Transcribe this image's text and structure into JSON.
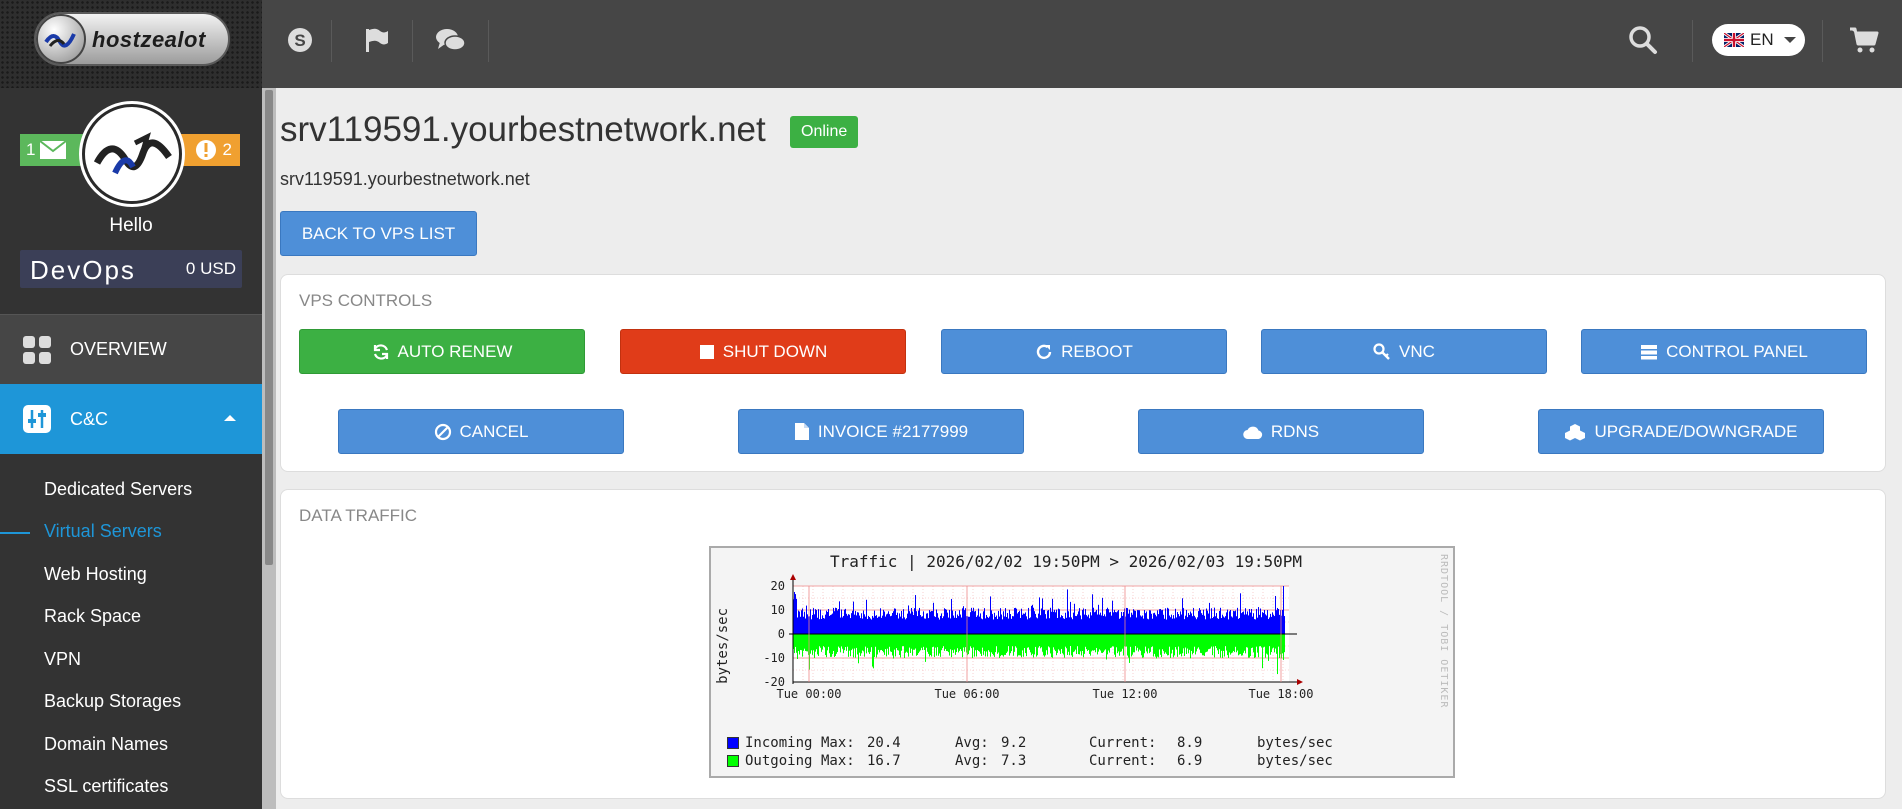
{
  "brand": {
    "logo_text": "hostzealot"
  },
  "topbar": {
    "icons": [
      "skype-icon",
      "flag-icon",
      "chat-icon"
    ],
    "language": "EN"
  },
  "sidebar": {
    "messages_count": "1",
    "alerts_count": "2",
    "greeting": "Hello",
    "username": "DevOps",
    "balance": "0 USD",
    "nav": {
      "overview": "OVERVIEW",
      "cc": "C&C"
    },
    "subitems": [
      "Dedicated Servers",
      "Virtual Servers",
      "Web Hosting",
      "Rack Space",
      "VPN",
      "Backup Storages",
      "Domain Names",
      "SSL certificates"
    ]
  },
  "server": {
    "hostname": "srv119591.yourbestnetwork.net",
    "status": "Online",
    "subtitle": "srv119591.yourbestnetwork.net",
    "back_label": "BACK TO VPS LIST"
  },
  "controls": {
    "title": "VPS CONTROLS",
    "row1": [
      "AUTO RENEW",
      "SHUT DOWN",
      "REBOOT",
      "VNC",
      "CONTROL PANEL"
    ],
    "row2": [
      "CANCEL",
      "INVOICE #2177999",
      "RDNS",
      "UPGRADE/DOWNGRADE"
    ]
  },
  "traffic": {
    "title": "DATA TRAFFIC",
    "side_text": "RRDTOOL / TOBI OETIKER"
  },
  "colors": {
    "incoming": "#0000ff",
    "outgoing": "#00ff00",
    "accent": "#1e96d8",
    "button_blue": "#4e8fd8",
    "green": "#3cb043",
    "red": "#e03c19"
  },
  "chart_data": {
    "type": "area",
    "title": "Traffic | 2026/02/02 19:50PM > 2026/02/03 19:50PM",
    "ylabel": "bytes/sec",
    "ylim": [
      -20,
      20
    ],
    "yticks": [
      "20",
      "10",
      "0",
      "-10",
      "-20"
    ],
    "xticks": [
      "Tue 00:00",
      "Tue 06:00",
      "Tue 12:00",
      "Tue 18:00"
    ],
    "grid": true,
    "series": [
      {
        "name": "Incoming",
        "color": "#0000ff",
        "max": "20.4",
        "avg": "9.2",
        "current": "8.9",
        "unit": "bytes/sec"
      },
      {
        "name": "Outgoing",
        "color": "#00ff00",
        "max": "16.7",
        "avg": "7.3",
        "current": "6.9",
        "unit": "bytes/sec"
      }
    ],
    "legend_labels": {
      "max": "Max:",
      "avg": "Avg:",
      "current": "Current:"
    }
  }
}
